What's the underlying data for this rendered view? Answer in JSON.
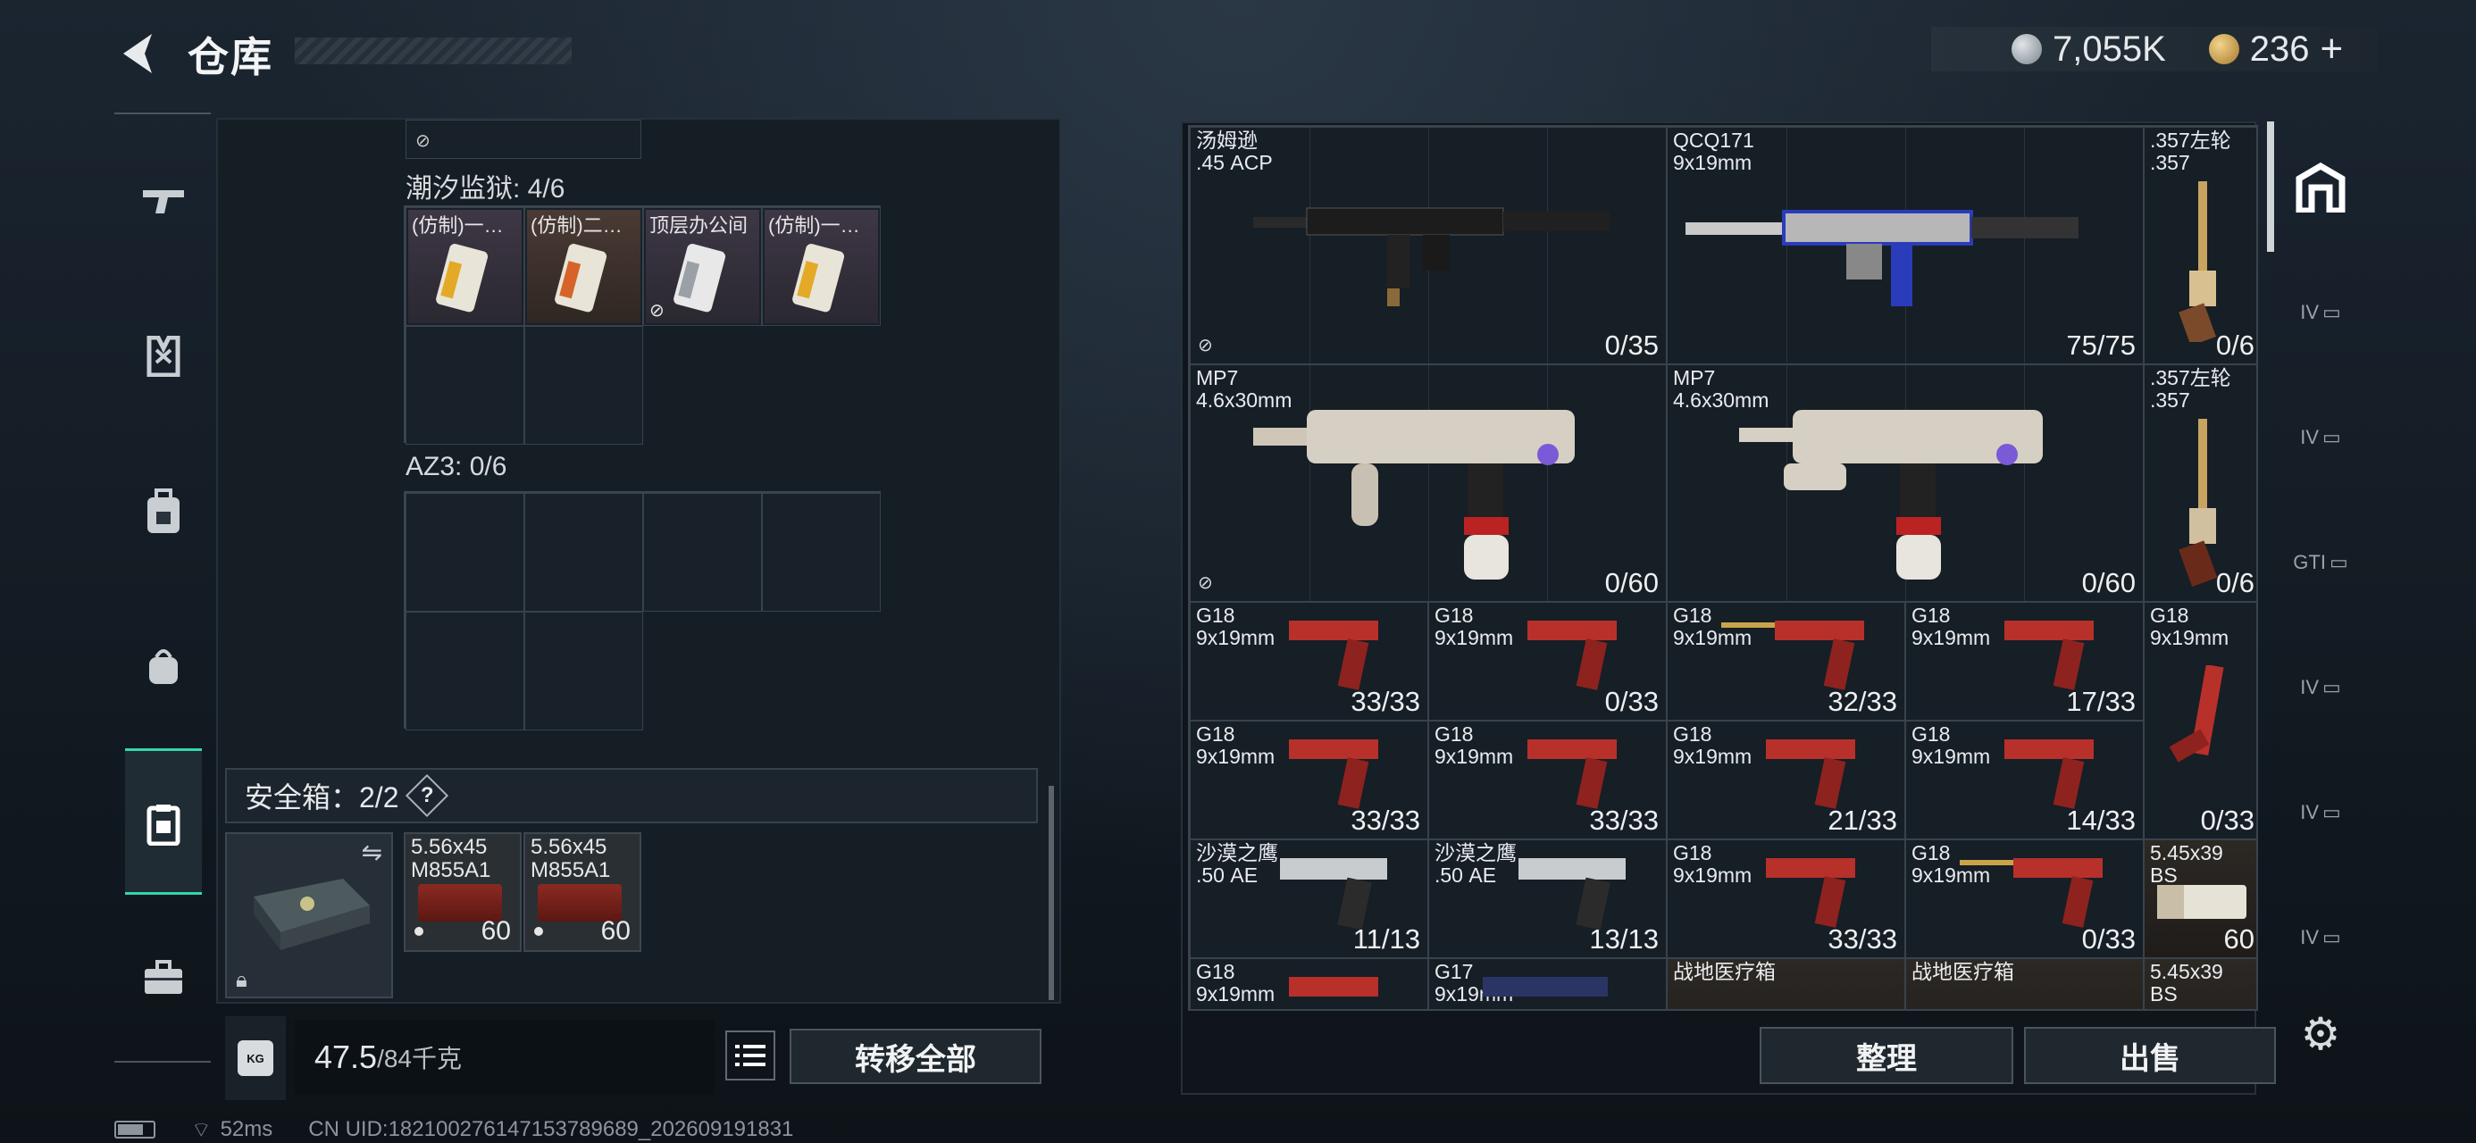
{
  "header": {
    "title": "仓库",
    "silver_amount": "7,055K",
    "gold_amount": "236",
    "gold_add": "+"
  },
  "left_panel": {
    "section1_label": "潮汐监狱: 4/6",
    "section1_items": [
      "(仿制)一…",
      "(仿制)二…",
      "顶层办公间",
      "(仿制)一…"
    ],
    "section2_label": "AZ3: 0/6",
    "safe_label": "安全箱：2/2",
    "safe_help": "?",
    "ammo": [
      {
        "name": "5.56x45 M855A1",
        "count": "60"
      },
      {
        "name": "5.56x45 M855A1",
        "count": "60"
      }
    ]
  },
  "bottom_left": {
    "kg_icon": "KG",
    "weight_value": "47.5",
    "weight_max": "/84千克",
    "transfer_all": "转移全部"
  },
  "inventory": [
    {
      "name": "汤姆逊",
      "caliber": ".45 ACP",
      "count": "0/35",
      "locked": true
    },
    {
      "name": "QCQ171",
      "caliber": "9x19mm",
      "count": "75/75",
      "locked": false
    },
    {
      "name": ".357左轮",
      "caliber": ".357",
      "count": "0/6",
      "locked": false
    },
    {
      "name": "MP7",
      "caliber": "4.6x30mm",
      "count": "0/60",
      "locked": true
    },
    {
      "name": "MP7",
      "caliber": "4.6x30mm",
      "count": "0/60",
      "locked": false
    },
    {
      "name": ".357左轮",
      "caliber": ".357",
      "count": "0/6",
      "locked": false
    },
    {
      "name": "G18",
      "caliber": "9x19mm",
      "count": "33/33"
    },
    {
      "name": "G18",
      "caliber": "9x19mm",
      "count": "0/33"
    },
    {
      "name": "G18",
      "caliber": "9x19mm",
      "count": "32/33"
    },
    {
      "name": "G18",
      "caliber": "9x19mm",
      "count": "17/33"
    },
    {
      "name": "G18",
      "caliber": "9x19mm",
      "count": "0/33"
    },
    {
      "name": "G18",
      "caliber": "9x19mm",
      "count": "33/33"
    },
    {
      "name": "G18",
      "caliber": "9x19mm",
      "count": "33/33"
    },
    {
      "name": "G18",
      "caliber": "9x19mm",
      "count": "21/33"
    },
    {
      "name": "G18",
      "caliber": "9x19mm",
      "count": "14/33"
    },
    {
      "name": "沙漠之鹰",
      "caliber": ".50 AE",
      "count": "11/13"
    },
    {
      "name": "沙漠之鹰",
      "caliber": ".50 AE",
      "count": "13/13"
    },
    {
      "name": "G18",
      "caliber": "9x19mm",
      "count": "33/33"
    },
    {
      "name": "G18",
      "caliber": "9x19mm",
      "count": "0/33"
    },
    {
      "name": "5.45x39",
      "caliber": "BS",
      "count": "60"
    },
    {
      "name": "G18",
      "caliber": "9x19mm",
      "count": ""
    },
    {
      "name": "G17",
      "caliber": "9x19mm",
      "count": ""
    },
    {
      "name": "战地医疗箱",
      "caliber": "",
      "count": ""
    },
    {
      "name": "战地医疗箱",
      "caliber": "",
      "count": ""
    },
    {
      "name": "5.45x39",
      "caliber": "BS",
      "count": ""
    }
  ],
  "right_tabs": [
    "",
    "IV",
    "IV",
    "GTI",
    "IV",
    "IV",
    "IV"
  ],
  "actions": {
    "organize": "整理",
    "sell": "出售"
  },
  "status_bar": {
    "ping": "52ms",
    "uid": "CN UID:18210027614715378968​9_202609191831"
  },
  "colors": {
    "accent": "#35d5ad",
    "gun_red": "#b8302a"
  },
  "icons": [
    "back-arrow-icon",
    "silver-coin-icon",
    "gold-coin-icon",
    "rifle-icon",
    "armor-icon",
    "backpack-icon",
    "bag-icon",
    "safe-box-icon",
    "toolbox-icon",
    "lock-icon",
    "swap-icon",
    "list-icon",
    "kg-icon",
    "home-tab-icon",
    "settings-gear-icon",
    "battery-icon",
    "wifi-icon"
  ]
}
